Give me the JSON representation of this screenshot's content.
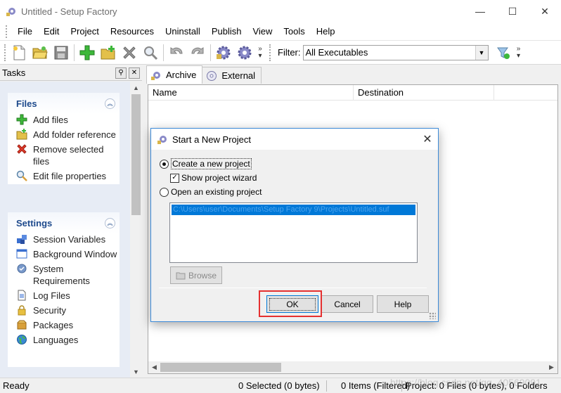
{
  "window": {
    "title": "Untitled - Setup Factory",
    "minimize": "—",
    "maximize": "☐",
    "close": "✕"
  },
  "menu": [
    "File",
    "Edit",
    "Project",
    "Resources",
    "Uninstall",
    "Publish",
    "View",
    "Tools",
    "Help"
  ],
  "toolbar": {
    "more": "»",
    "filter_label": "Filter:",
    "filter_value": "All Executables"
  },
  "tasks": {
    "title": "Tasks",
    "files": {
      "title": "Files",
      "items": [
        "Add files",
        "Add folder reference",
        "Remove selected files",
        "Edit file properties"
      ]
    },
    "settings": {
      "title": "Settings",
      "items": [
        "Session Variables",
        "Background Window",
        "System Requirements",
        "Log Files",
        "Security",
        "Packages",
        "Languages"
      ]
    }
  },
  "tabs": [
    "Archive",
    "External"
  ],
  "list": {
    "columns": [
      "Name",
      "Destination"
    ]
  },
  "status": {
    "ready": "Ready",
    "selected": "0 Selected (0 bytes)",
    "items": "0 Items (Filtered)",
    "project": "Project: 0 Files (0 bytes), 0 Folders"
  },
  "dialog": {
    "title": "Start a New Project",
    "create_new": "Create a new project",
    "show_wizard": "Show project wizard",
    "open_existing": "Open an existing project",
    "recent_path": "C:\\Users\\user\\Documents\\Setup Factory 9\\Projects\\Untitled.suf",
    "browse": "Browse",
    "ok": "OK",
    "cancel": "Cancel",
    "help": "Help"
  },
  "watermark": "https://blog.csdn.net/qq_40569091",
  "colors": {
    "accent": "#0078d7",
    "highlight": "#e53030",
    "panel_title": "#1e4a8c"
  }
}
